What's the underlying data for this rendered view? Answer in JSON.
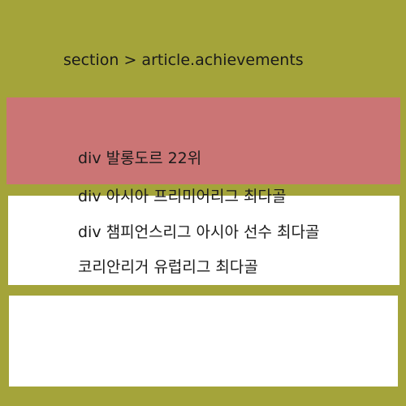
{
  "heading": "section > article.achievements",
  "lines": [
    "div 발롱도르 22위",
    "div 아시아 프리미어리그 최다골",
    "div 챔피언스리그 아시아 선수 최다골",
    "코리안리거 유럽리그 최다골"
  ],
  "colors": {
    "background": "#a4a43a",
    "highlight_box": "#cb7575",
    "white_box": "#ffffff"
  }
}
